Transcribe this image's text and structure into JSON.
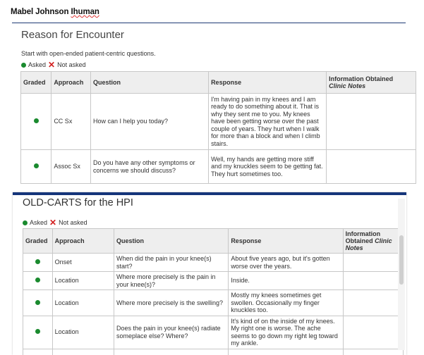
{
  "patient_name_first": "Mabel Johnson",
  "patient_name_last": "Ihuman",
  "reason": {
    "title": "Reason for Encounter",
    "intro": "Start with open-ended patient-centric questions.",
    "legend_asked": "Asked",
    "legend_not_asked": "Not asked",
    "headers": [
      "Graded",
      "Approach",
      "Question",
      "Response",
      "Information Obtained",
      "Clinic Notes"
    ],
    "rows": [
      {
        "approach": "CC Sx",
        "question": "How can I help you today?",
        "response": "I'm having pain in my knees and I am ready to do something about it. That is why they sent me to you. My knees have been getting worse over the past couple of years. They hurt when I walk for more than a block and when I climb stairs."
      },
      {
        "approach": "Assoc Sx",
        "question": "Do you have any other symptoms or concerns we should discuss?",
        "response": "Well, my hands are getting more stiff and my knuckles seem to be getting fat. They hurt sometimes too."
      }
    ]
  },
  "hpi": {
    "title": "OLD-CARTS for the HPI",
    "legend_asked": "Asked",
    "legend_not_asked": "Not asked",
    "headers": [
      "Graded",
      "Approach",
      "Question",
      "Response",
      "Information Obtained",
      "Clinic Notes"
    ],
    "rows": [
      {
        "approach": "Onset",
        "question": "When did the pain in your knee(s) start?",
        "response": "About five years ago, but it's gotten worse over the years."
      },
      {
        "approach": "Location",
        "question": "Where more precisely is the pain in your knee(s)?",
        "response": "Inside."
      },
      {
        "approach": "Location",
        "question": "Where more precisely is the swelling?",
        "response": "Mostly my knees sometimes get swollen. Occasionally my finger knuckles too."
      },
      {
        "approach": "Location",
        "question": "Does the pain in your knee(s) radiate someplace else? Where?",
        "response": "It's kind of on the inside of my knees. My right one is worse. The ache seems to go down my right leg toward my ankle."
      }
    ]
  },
  "colors": {
    "asked": "#1a8a2e",
    "not_asked": "#d21f1f",
    "accent": "#15357a"
  }
}
